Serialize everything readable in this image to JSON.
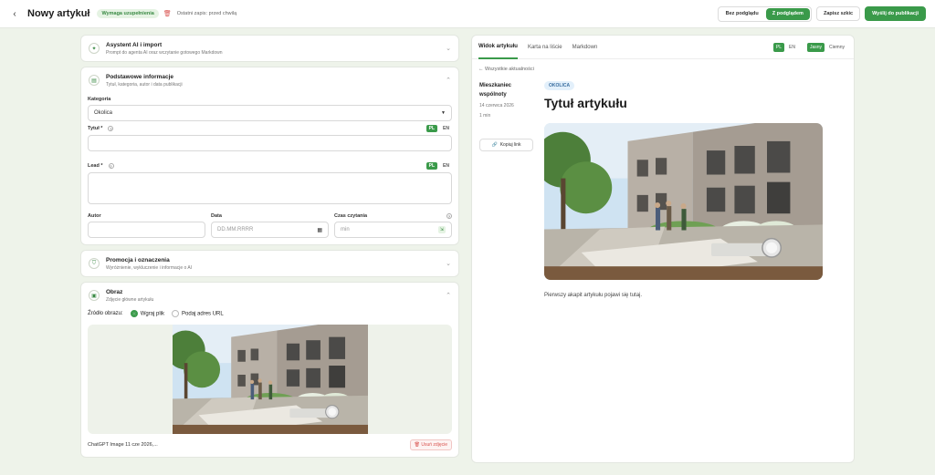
{
  "header": {
    "back": "‹",
    "title": "Nowy artykuł",
    "badge": "Wymaga uzupełnienia",
    "saved": "Ostatni zapis: przed chwilą",
    "preview_off": "Bez podglądu",
    "preview_on": "Z podglądem",
    "save_draft": "Zapisz szkic",
    "publish": "Wyślij do publikacji"
  },
  "sections": {
    "ai": {
      "title": "Asystent AI i import",
      "subtitle": "Prompt do agenta AI oraz wczytanie gotowego Markdown"
    },
    "basic": {
      "title": "Podstawowe informacje",
      "subtitle": "Tytuł, kategoria, autor i data publikacji",
      "category_label": "Kategoria",
      "category_value": "Okolica",
      "title_label": "Tytuł *",
      "lead_label": "Lead *",
      "lang_pl": "PL",
      "lang_en": "EN",
      "author_label": "Autor",
      "date_label": "Data",
      "date_placeholder": "DD.MM.RRRR",
      "read_label": "Czas czytania",
      "read_placeholder": "min",
      "q": "?"
    },
    "promo": {
      "title": "Promocja i oznaczenia",
      "subtitle": "Wyróżnienie, wykluczenie i informacje o AI"
    },
    "image": {
      "title": "Obraz",
      "subtitle": "Zdjęcie główne artykułu",
      "source_label": "Źródło obrazu:",
      "opt_file": "Wgraj plik",
      "opt_url": "Podaj adres URL",
      "file_name": "ChatGPT Image 11 cze 2026,...",
      "remove": "Usuń zdjęcie"
    }
  },
  "preview": {
    "tabs": [
      "Widok artykułu",
      "Karta na liście",
      "Markdown"
    ],
    "lang_pl": "PL",
    "lang_en": "EN",
    "theme_light": "Jasny",
    "theme_dark": "Ciemny",
    "all_news": "← Wszystkie aktualności",
    "author_line1": "Mieszkaniec",
    "author_line2": "wspólnoty",
    "date": "14 czerwca 2026",
    "read": "1 min",
    "copy": "Kopiuj link",
    "category": "OKOLICA",
    "title": "Tytuł artykułu",
    "paragraph": "Pierwszy akapit artykułu pojawi się tutaj."
  },
  "colors": {
    "accent": "#3a9a4a",
    "bg": "#eef3ea"
  }
}
